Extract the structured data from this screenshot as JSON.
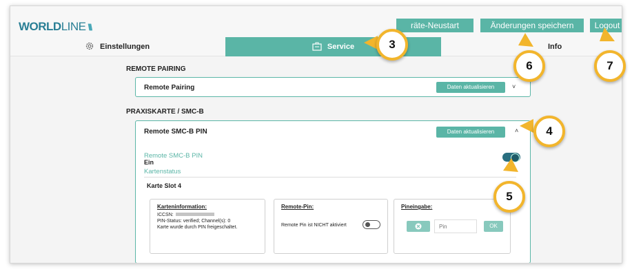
{
  "header": {
    "logo_bold": "WORLD",
    "logo_thin": "LINE",
    "logo_mark": "\\\\\\\\\\\\",
    "btn_neustart": "räte-Neustart",
    "btn_save": "Änderungen speichern",
    "btn_logout": "Logout"
  },
  "nav": {
    "einstellungen": "Einstellungen",
    "service": "Service",
    "info": "Info"
  },
  "remote_pairing": {
    "section_title": "REMOTE PAIRING",
    "panel_title": "Remote Pairing",
    "refresh_label": "Daten aktualisieren",
    "chevron": "˅"
  },
  "praxiskarte": {
    "section_title": "PRAXISKARTE / SMC-B",
    "panel_title": "Remote SMC-B PIN",
    "refresh_label": "Daten aktualisieren",
    "chevron": "˄",
    "remote_pin_label": "Remote SMC-B PIN",
    "remote_pin_state": "Ein",
    "kartenstatus_label": "Kartenstatus",
    "slot_label": "Karte Slot 4",
    "cards": {
      "info": {
        "title": "Karteninformation:",
        "iccsn_label": "ICCSN:",
        "pin_status": "PIN-Status: verified; Channel(s): 0",
        "note": "Karte wurde durch PIN freigeschaltet."
      },
      "remote_pin": {
        "title": "Remote-Pin:",
        "status": "Remote Pin ist NICHT aktiviert"
      },
      "pineingabe": {
        "title": "Pineingabe:",
        "placeholder": "Pin",
        "ok_label": "OK"
      }
    }
  },
  "badges": [
    "3",
    "4",
    "5",
    "6",
    "7"
  ],
  "colors": {
    "accent": "#5ab5a6",
    "logo": "#2a7f95",
    "badge_ring": "#f2b52c"
  }
}
